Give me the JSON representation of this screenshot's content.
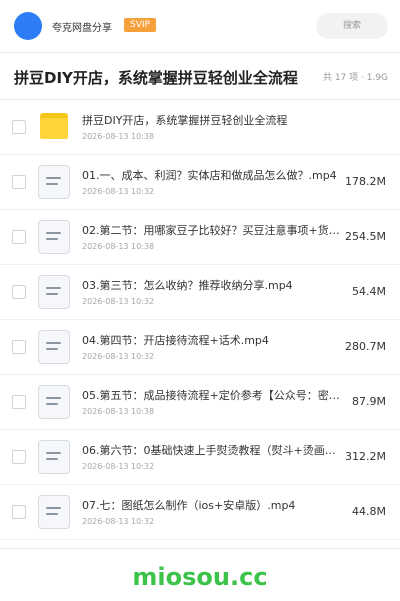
{
  "header": {
    "brand": "夸克网盘分享",
    "vip_badge": "SVIP",
    "search_placeholder": "搜索"
  },
  "folder": {
    "title": "拼豆DIY开店，系统掌握拼豆轻创业全流程",
    "meta": "共 17 项 · 1.9G"
  },
  "items": [
    {
      "name": "拼豆DIY开店，系统掌握拼豆轻创业全流程",
      "date": "2026-08-13 10:38",
      "size": "",
      "icon": "folder-icon"
    },
    {
      "name": "01.一、成本、利润？实体店和做成品怎么做？.mp4",
      "date": "2026-08-13 10:32",
      "size": "178.2M",
      "icon": "video-file-icon"
    },
    {
      "name": "02.第二节：用哪家豆子比较好？买豆注意事项+货源…",
      "date": "2026-08-13 10:38",
      "size": "254.5M",
      "icon": "video-file-icon"
    },
    {
      "name": "03.第三节：怎么收纳？推荐收纳分享.mp4",
      "date": "2026-08-13 10:32",
      "size": "54.4M",
      "icon": "video-file-icon"
    },
    {
      "name": "04.第四节：开店接待流程+话术.mp4",
      "date": "2026-08-13 10:32",
      "size": "280.7M",
      "icon": "video-file-icon"
    },
    {
      "name": "05.第五节：成品接待流程+定价参考【公众号：密知…",
      "date": "2026-08-13 10:38",
      "size": "87.9M",
      "icon": "video-file-icon"
    },
    {
      "name": "06.第六节：0基础快速上手熨烫教程（熨斗+烫画机…",
      "date": "2026-08-13 10:32",
      "size": "312.2M",
      "icon": "video-file-icon"
    },
    {
      "name": "07.七：图纸怎么制作（ios+安卓版）.mp4",
      "date": "2026-08-13 10:32",
      "size": "44.8M",
      "icon": "video-file-icon"
    }
  ],
  "watermark": "miosou.cc",
  "colors": {
    "accent": "#2f7df6",
    "vip": "#f6a03a",
    "folder": "#ffd43b",
    "watermark": "#3cc34a"
  }
}
